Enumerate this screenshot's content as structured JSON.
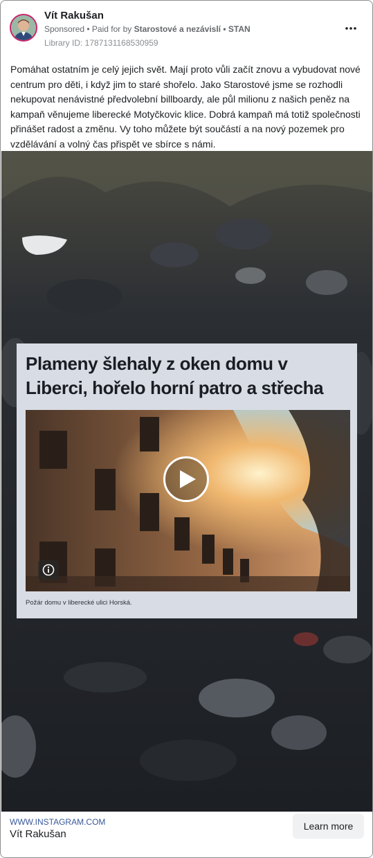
{
  "post": {
    "author": "Vít Rakušan",
    "sponsored_label": "Sponsored",
    "separator": " • ",
    "paid_prefix": "Paid for by ",
    "paid_by": "Starostové a nezávislí • STAN",
    "library_id": "Library ID: 1787131168530959",
    "more_icon": "more-horizontal-icon",
    "text": "Pomáhat ostatním je celý jejich svět. Mají proto vůli začít znovu a vybudovat nové centrum pro děti, i když jim to staré shořelo. Jako Starostové jsme se rozhodli nekupovat nenávistné předvolební billboardy, ale půl milionu z našich peněz na kampaň věnujeme liberecké Motyčkovic klice. Dobrá kampaň má totiž společnosti přinášet radost a změnu. Vy toho můžete být součástí a na nový pozemek pro vzdělávání a volný čas přispět ve sbírce s námi."
  },
  "media": {
    "headline": "Plameny šlehaly z oken domu v Liberci, hořelo horní patro a střecha",
    "caption": "Požár domu v liberecké ulici Horská.",
    "play_icon": "play-icon",
    "info_icon": "info-icon"
  },
  "footer": {
    "url": "WWW.INSTAGRAM.COM",
    "name": "Vít Rakušan",
    "cta_label": "Learn more"
  },
  "colors": {
    "avatar_ring": "#c8246b",
    "link": "#385898",
    "cta_bg": "#eff1f3"
  }
}
